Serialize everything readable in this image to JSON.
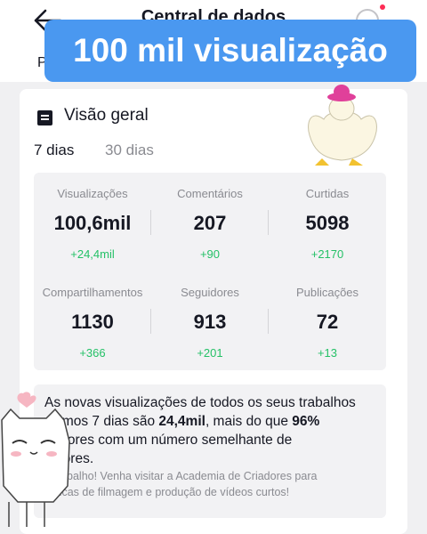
{
  "header": {
    "title": "Central de dados",
    "tab_fragment": "P"
  },
  "overlay": {
    "caption": "100 mil visualização"
  },
  "overview": {
    "title": "Visão geral",
    "periods": [
      "7 dias",
      "30 dias"
    ],
    "selected_period": "7 dias"
  },
  "stats": [
    {
      "label": "Visualizações",
      "value": "100,6mil",
      "delta": "+24,4mil"
    },
    {
      "label": "Comentários",
      "value": "207",
      "delta": "+90"
    },
    {
      "label": "Curtidas",
      "value": "5098",
      "delta": "+2170"
    },
    {
      "label": "Compartilhamentos",
      "value": "1130",
      "delta": "+366"
    },
    {
      "label": "Seguidores",
      "value": "913",
      "delta": "+201"
    },
    {
      "label": "Publicações",
      "value": "72",
      "delta": "+13"
    }
  ],
  "info": {
    "line1": "As novas visualizações de todos os seus trabalhos",
    "part2": "últimos 7 dias são ",
    "highlight_views": "24,4mil",
    "part3": ", mais do que ",
    "highlight_percent": "96%",
    "line3": "riadores com um número semelhante de",
    "line4": "uidores.",
    "sub_line1": "n trabalho! Venha visitar a Academia de Criadores para",
    "sub_line2": "s dicas de filmagem e produção de vídeos curtos!"
  },
  "colors": {
    "accent_blue": "#4a98f0",
    "positive_green": "#25c167",
    "muted_gray": "#8a8b91",
    "notification_red": "#fe2c55"
  },
  "icons": {
    "back": "arrow-left-icon",
    "help": "help-circle-icon",
    "overview": "document-icon"
  }
}
